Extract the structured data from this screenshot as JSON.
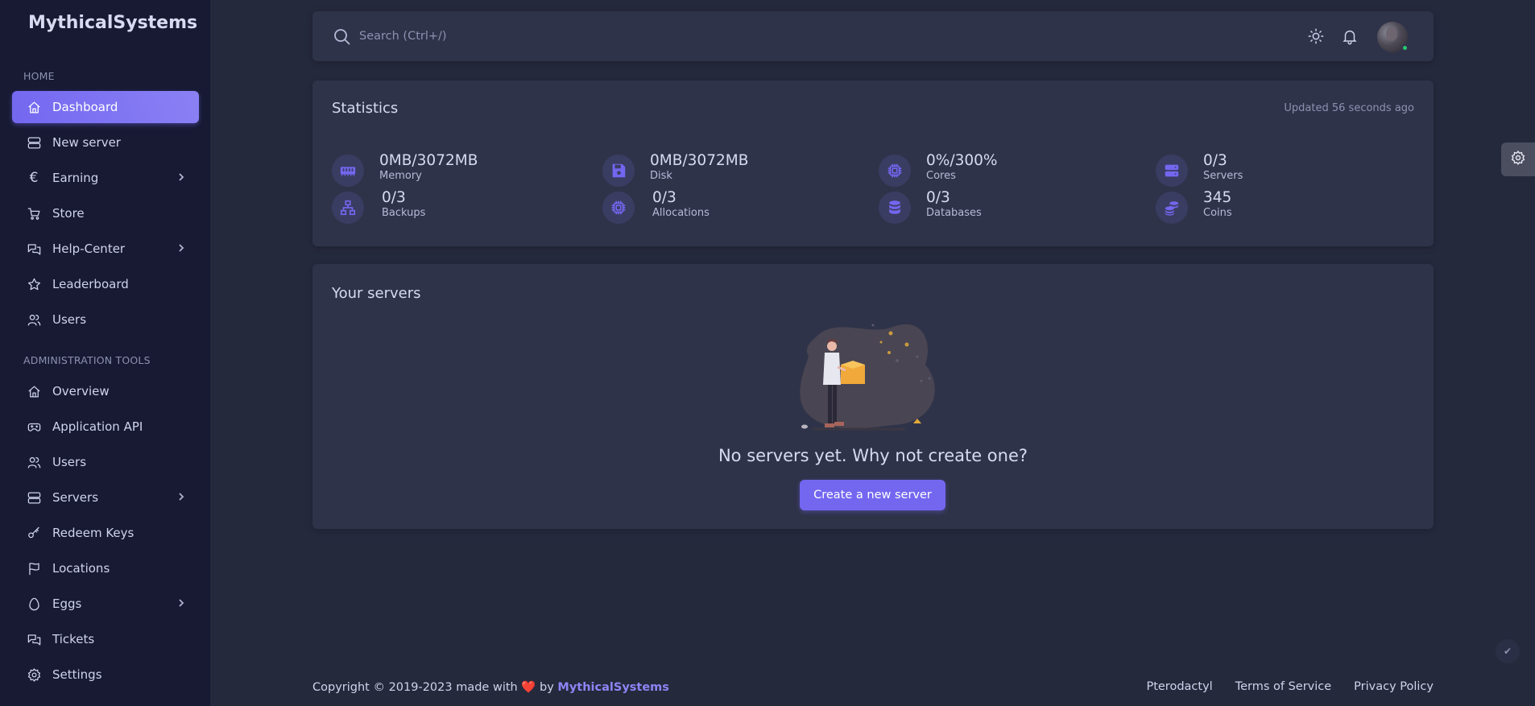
{
  "sidebar": {
    "brand": "MythicalSystems",
    "home_section": "HOME",
    "admin_section": "ADMINISTRATION TOOLS",
    "home_items": [
      {
        "label": "Dashboard",
        "icon": "home-icon"
      },
      {
        "label": "New server",
        "icon": "server-icon"
      },
      {
        "label": "Earning",
        "icon": "euro-icon"
      },
      {
        "label": "Store",
        "icon": "cart-icon"
      },
      {
        "label": "Help-Center",
        "icon": "messages-icon"
      },
      {
        "label": "Leaderboard",
        "icon": "star-icon"
      },
      {
        "label": "Users",
        "icon": "users-icon"
      }
    ],
    "admin_items": [
      {
        "label": "Overview",
        "icon": "home-icon"
      },
      {
        "label": "Application API",
        "icon": "gamepad-icon"
      },
      {
        "label": "Users",
        "icon": "users-icon"
      },
      {
        "label": "Servers",
        "icon": "server-icon"
      },
      {
        "label": "Redeem Keys",
        "icon": "key-icon"
      },
      {
        "label": "Locations",
        "icon": "flag-icon"
      },
      {
        "label": "Eggs",
        "icon": "egg-icon"
      },
      {
        "label": "Tickets",
        "icon": "messages-icon"
      },
      {
        "label": "Settings",
        "icon": "gear-icon"
      }
    ]
  },
  "topbar": {
    "search_placeholder": "Search (Ctrl+/)"
  },
  "statistics": {
    "title": "Statistics",
    "updated": "Updated 56 seconds ago",
    "items": [
      {
        "value": "0MB/3072MB",
        "label": "Memory",
        "icon": "memory-icon"
      },
      {
        "value": "0MB/3072MB",
        "label": "Disk",
        "icon": "disk-icon"
      },
      {
        "value": "0%/300%",
        "label": "Cores",
        "icon": "cpu-icon"
      },
      {
        "value": "0/3",
        "label": "Servers",
        "icon": "server-stack-icon"
      },
      {
        "value": "0/3",
        "label": "Backups",
        "icon": "network-icon"
      },
      {
        "value": "0/3",
        "label": "Allocations",
        "icon": "cpu-icon"
      },
      {
        "value": "0/3",
        "label": "Databases",
        "icon": "database-icon"
      },
      {
        "value": "345",
        "label": "Coins",
        "icon": "coins-icon"
      }
    ]
  },
  "servers": {
    "title": "Your servers",
    "empty_message": "No servers yet. Why not create one?",
    "create_label": "Create a new server"
  },
  "footer": {
    "copyright_prefix": "Copyright © 2019-2023 made with",
    "heart": "❤️",
    "by": "by",
    "brand": "MythicalSystems",
    "links": [
      "Pterodactyl",
      "Terms of Service",
      "Privacy Policy"
    ]
  },
  "colors": {
    "accent": "#7367f0",
    "background": "#25293c",
    "card": "#2f3349",
    "sidebar": "#171a32"
  }
}
